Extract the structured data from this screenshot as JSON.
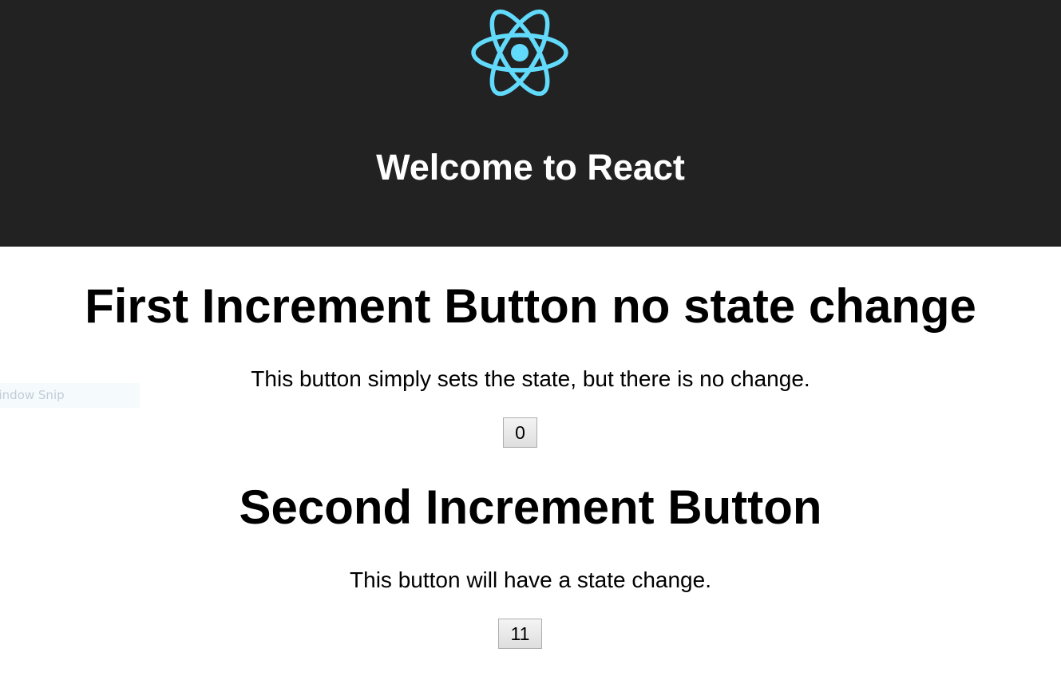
{
  "header": {
    "title": "Welcome to React",
    "logo_icon": "react-logo-icon",
    "background_color": "#222222",
    "logo_color": "#61dafb"
  },
  "sections": [
    {
      "title": "First Increment Button no state change",
      "description": "This button simply sets the state, but there is no change.",
      "button_value": "0"
    },
    {
      "title": "Second Increment Button",
      "description": "This button will have a state change.",
      "button_value": "11"
    }
  ],
  "overlay": {
    "text": "Window Snip"
  }
}
